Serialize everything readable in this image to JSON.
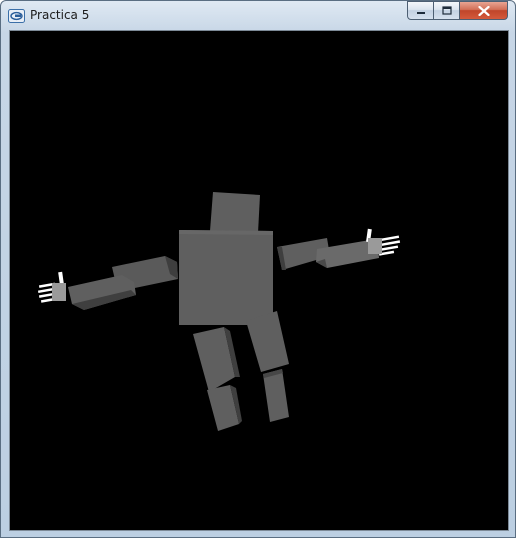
{
  "window": {
    "title": "Practica 5",
    "app_icon": "opengl-window-icon",
    "controls": {
      "minimize_icon": "minimize-icon",
      "maximize_icon": "maximize-icon",
      "close_icon": "close-icon"
    }
  },
  "scene": {
    "background_color": "#000000",
    "model": "robot",
    "parts": [
      "head",
      "torso",
      "left-upper-arm",
      "left-forearm",
      "left-hand",
      "right-upper-arm",
      "right-forearm",
      "right-hand",
      "left-thigh",
      "left-shin",
      "right-thigh",
      "right-shin"
    ],
    "colors": {
      "body_gray": "#5f5f5f",
      "body_dark": "#444444",
      "hand_white": "#ffffff"
    }
  }
}
